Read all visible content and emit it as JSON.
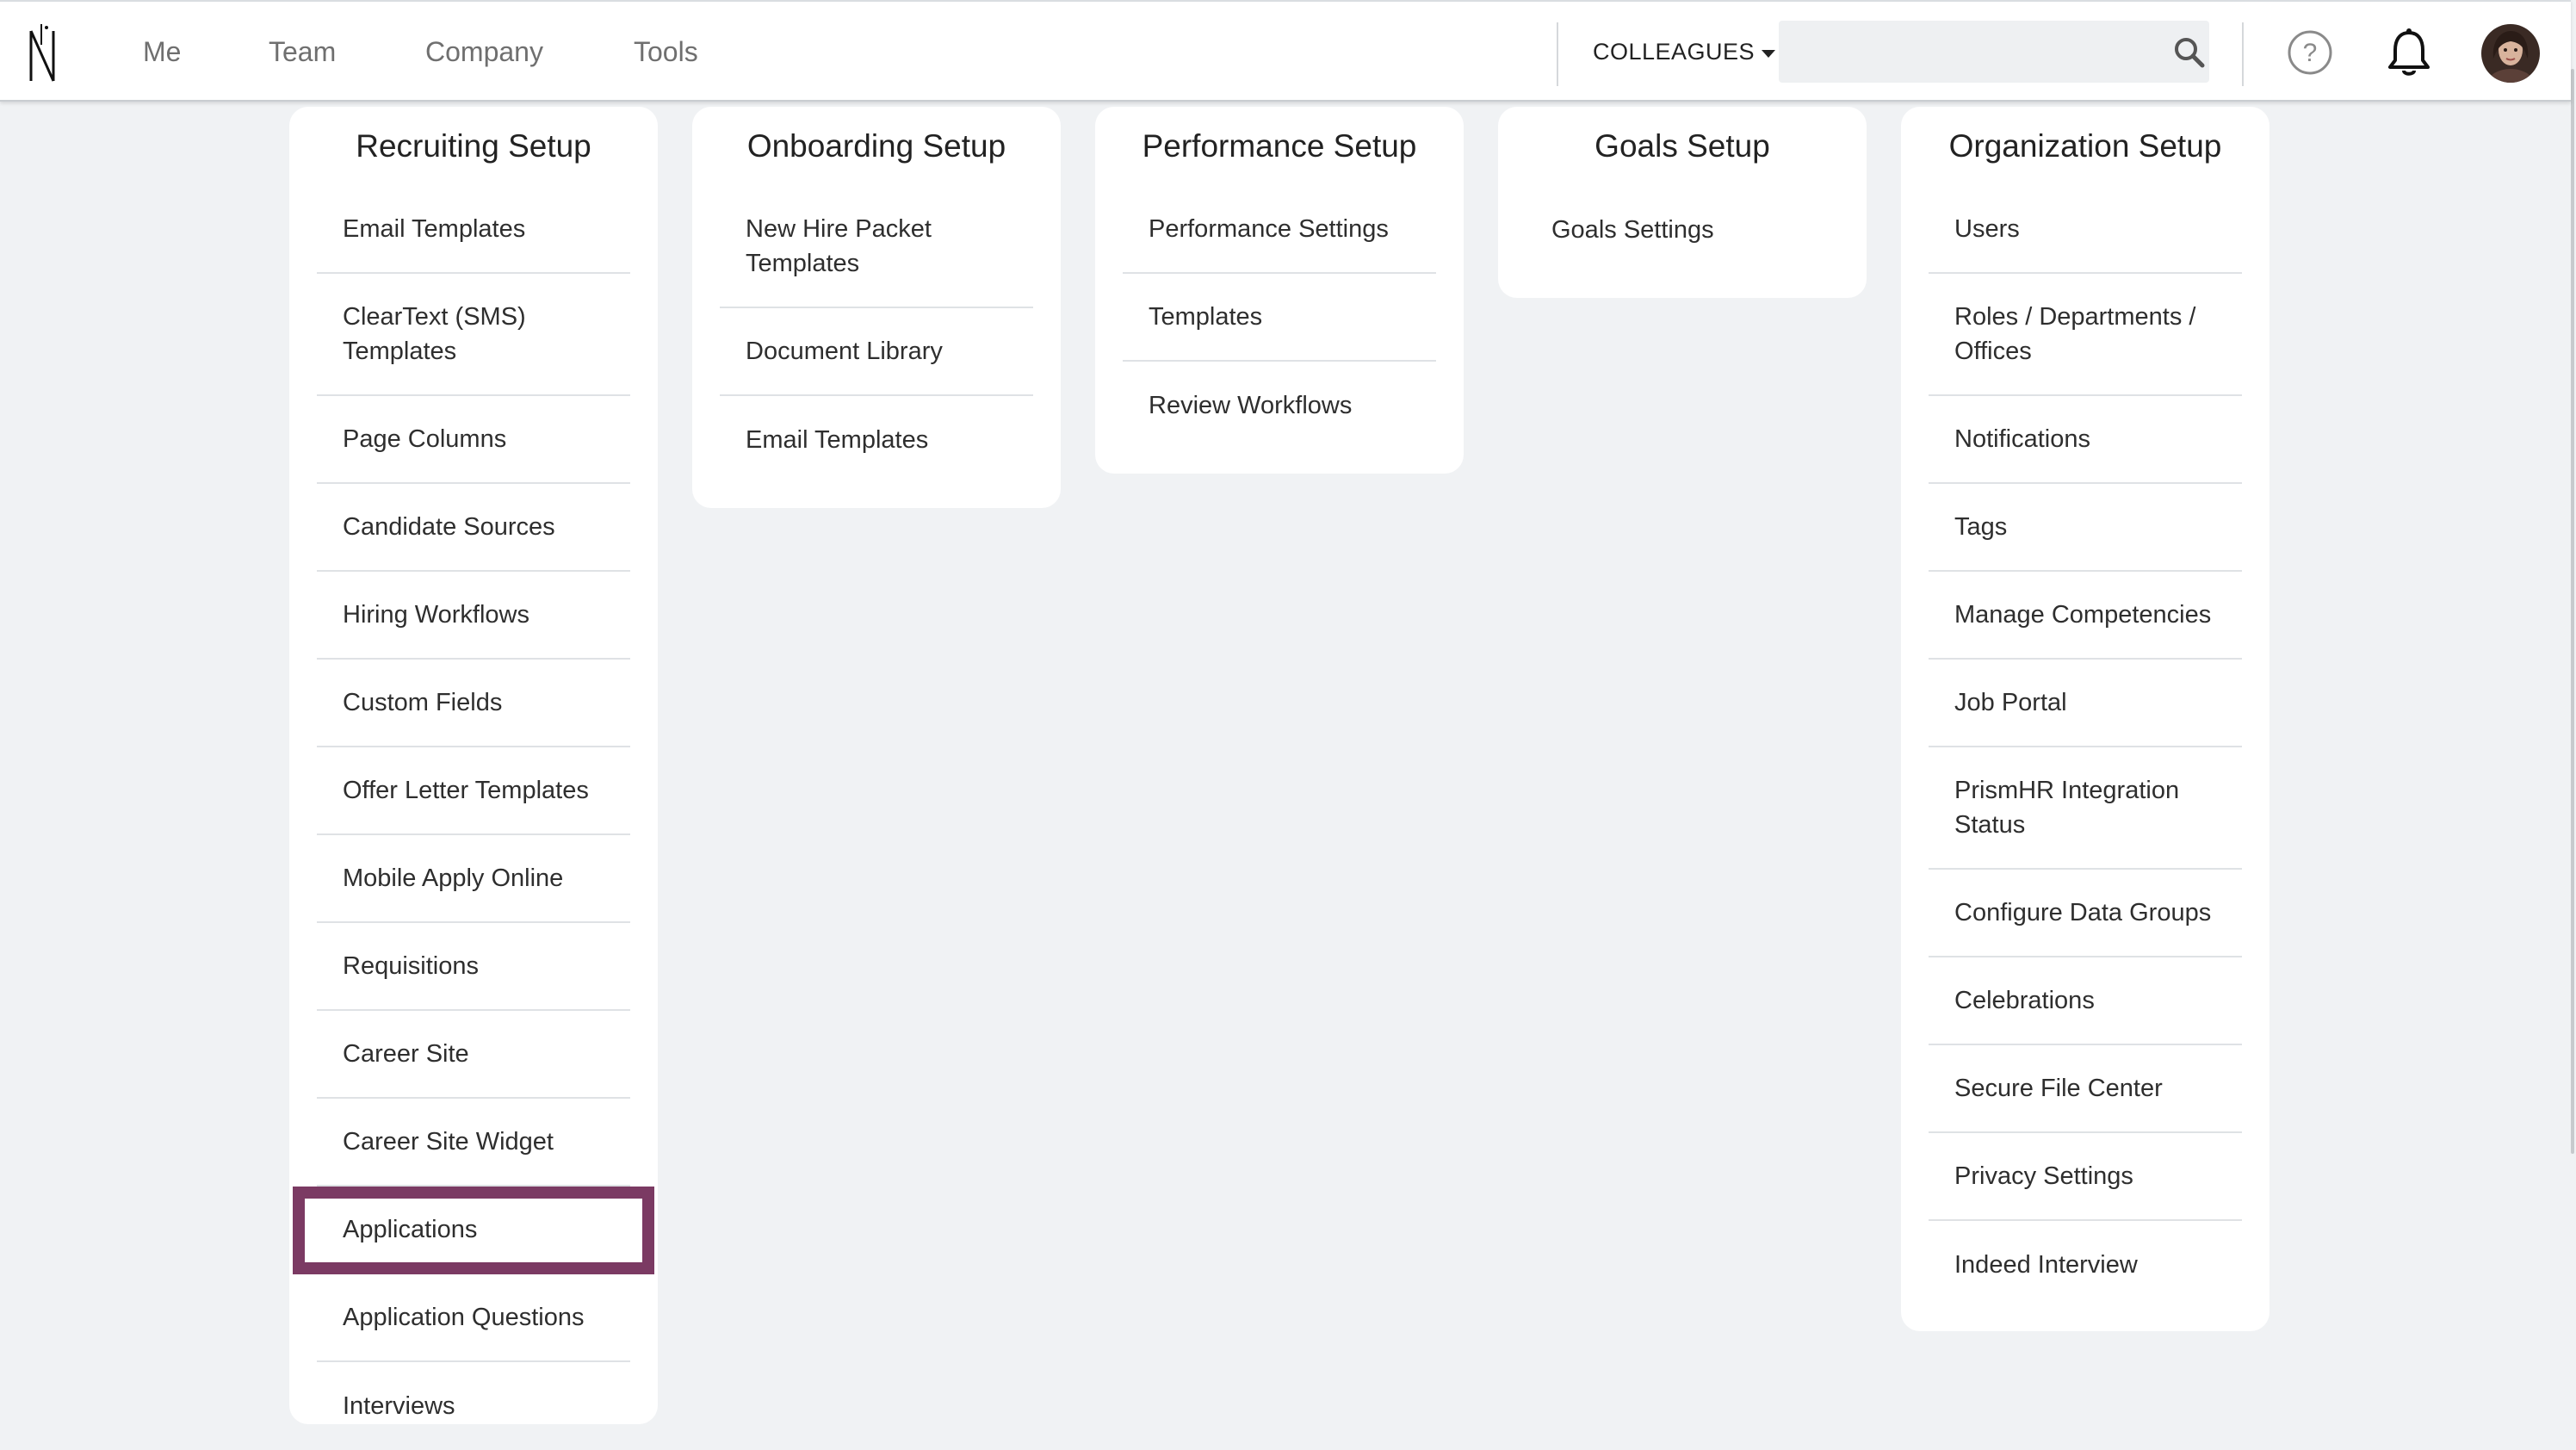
{
  "nav": {
    "items": [
      "Me",
      "Team",
      "Company",
      "Tools"
    ],
    "colleagues_label": "COLLEAGUES",
    "search_placeholder": ""
  },
  "colors": {
    "highlight": "#7b3a63",
    "page_bg": "#f0f2f4",
    "card_bg": "#ffffff"
  },
  "icons": [
    "logo-icon",
    "search-icon",
    "help-icon",
    "bell-icon",
    "avatar"
  ],
  "cards": {
    "recruiting": {
      "title": "Recruiting Setup",
      "items": [
        "Email Templates",
        "ClearText (SMS) Templates",
        "Page Columns",
        "Candidate Sources",
        "Hiring Workflows",
        "Custom Fields",
        "Offer Letter Templates",
        "Mobile Apply Online",
        "Requisitions",
        "Career Site",
        "Career Site Widget",
        "Applications",
        "Application Questions",
        "Interviews"
      ],
      "selected_item": "Applications"
    },
    "onboarding": {
      "title": "Onboarding Setup",
      "items": [
        "New Hire Packet Templates",
        "Document Library",
        "Email Templates"
      ]
    },
    "performance": {
      "title": "Performance Setup",
      "items": [
        "Performance Settings",
        "Templates",
        "Review Workflows"
      ]
    },
    "goals": {
      "title": "Goals Setup",
      "items": [
        "Goals Settings"
      ]
    },
    "organization": {
      "title": "Organization Setup",
      "items": [
        "Users",
        "Roles / Departments / Offices",
        "Notifications",
        "Tags",
        "Manage Competencies",
        "Job Portal",
        "PrismHR Integration Status",
        "Configure Data Groups",
        "Celebrations",
        "Secure File Center",
        "Privacy Settings",
        "Indeed Interview"
      ]
    }
  }
}
